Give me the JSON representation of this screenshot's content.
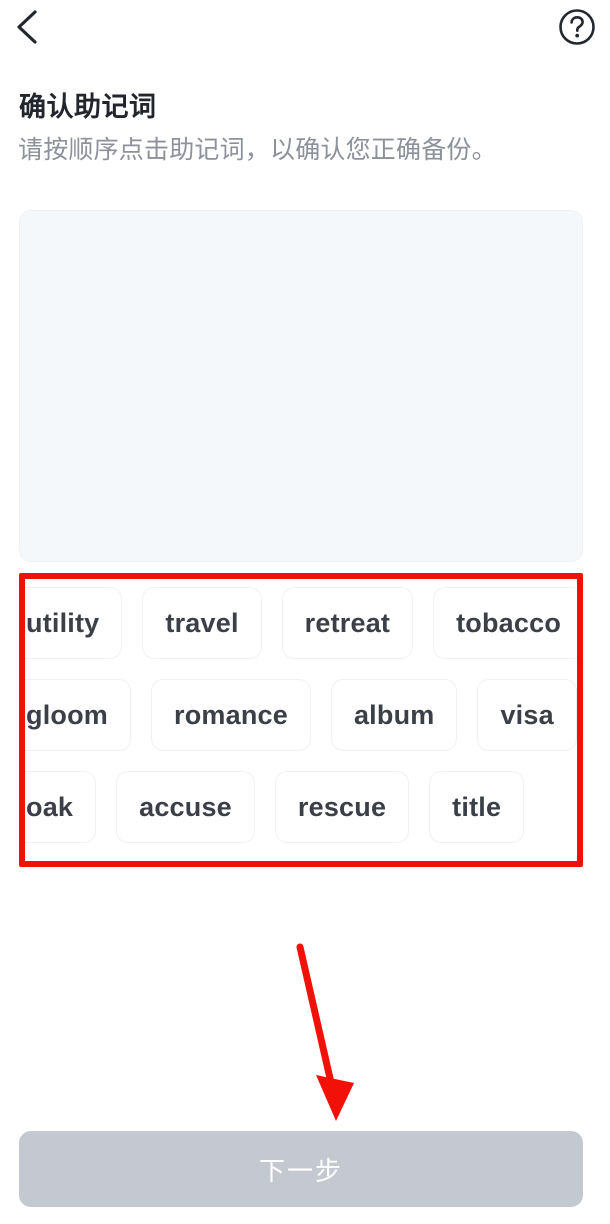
{
  "header": {
    "back_icon": "chevron-left-icon",
    "help_icon": "question-circle-icon"
  },
  "page": {
    "title": "确认助记词",
    "subtitle": "请按顺序点击助记词，以确认您正确备份。"
  },
  "selected_panel": {
    "words": [],
    "background_color": "#f5f8fa"
  },
  "word_bank": {
    "rows": [
      {
        "words": [
          "utility",
          "travel",
          "retreat",
          "tobacco"
        ]
      },
      {
        "words": [
          "gloom",
          "romance",
          "album",
          "visa"
        ]
      },
      {
        "words": [
          "oak",
          "accuse",
          "rescue",
          "title"
        ]
      }
    ]
  },
  "annotations": {
    "highlight_color": "#f21108",
    "box_label": "word-bank-highlight",
    "arrow_label": "points-to-next-button"
  },
  "footer": {
    "next_label": "下一步",
    "next_enabled": false,
    "next_color": "#c4c8d0"
  }
}
